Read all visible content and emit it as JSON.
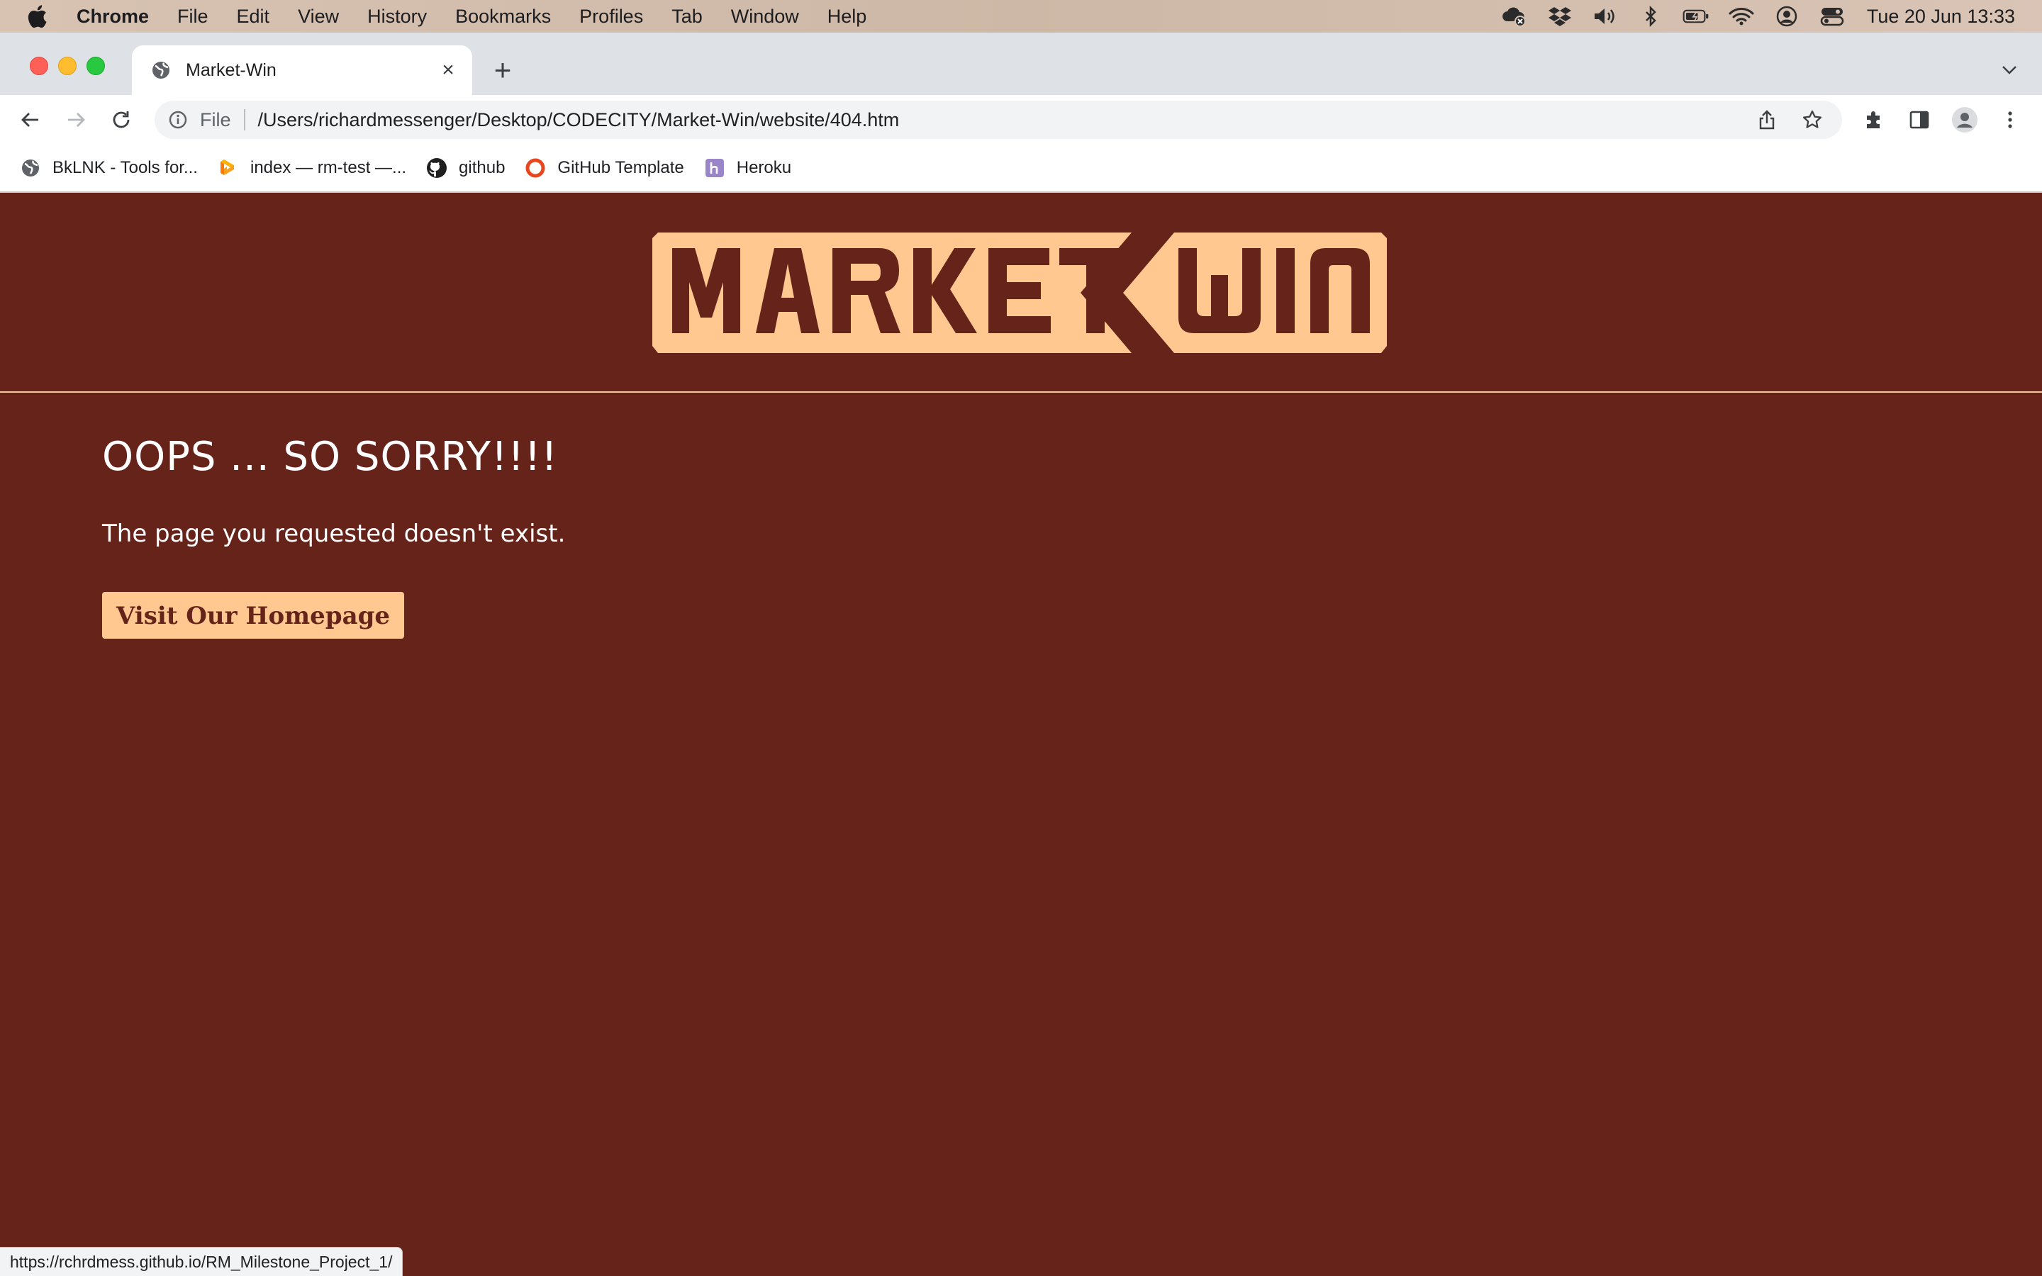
{
  "menubar": {
    "app_name": "Chrome",
    "items": [
      "File",
      "Edit",
      "View",
      "History",
      "Bookmarks",
      "Profiles",
      "Tab",
      "Window",
      "Help"
    ],
    "clock": "Tue 20 Jun  13:33"
  },
  "browser": {
    "tab": {
      "title": "Market-Win",
      "close": "×"
    },
    "new_tab": "+",
    "address": {
      "scheme": "File",
      "url": "/Users/richardmessenger/Desktop/CODECITY/Market-Win/website/404.htm"
    },
    "bookmarks": [
      {
        "label": "BkLNK - Tools for...",
        "icon": "globe-icon"
      },
      {
        "label": "index — rm-test —...",
        "icon": "g-logo-icon"
      },
      {
        "label": "github",
        "icon": "github-icon"
      },
      {
        "label": "GitHub Template",
        "icon": "ring-icon"
      },
      {
        "label": "Heroku",
        "icon": "heroku-icon"
      }
    ],
    "status_url": "https://rchrdmess.github.io/RM_Milestone_Project_1/"
  },
  "page": {
    "logo_text": "MARKET WIN",
    "heading": "OOPS ... SO SORRY!!!!",
    "message": "The page you requested doesn't exist.",
    "cta_label": "Visit Our Homepage"
  },
  "colors": {
    "page_background": "#66231a",
    "logo_fill": "#ffc890",
    "text": "#ffffff"
  }
}
